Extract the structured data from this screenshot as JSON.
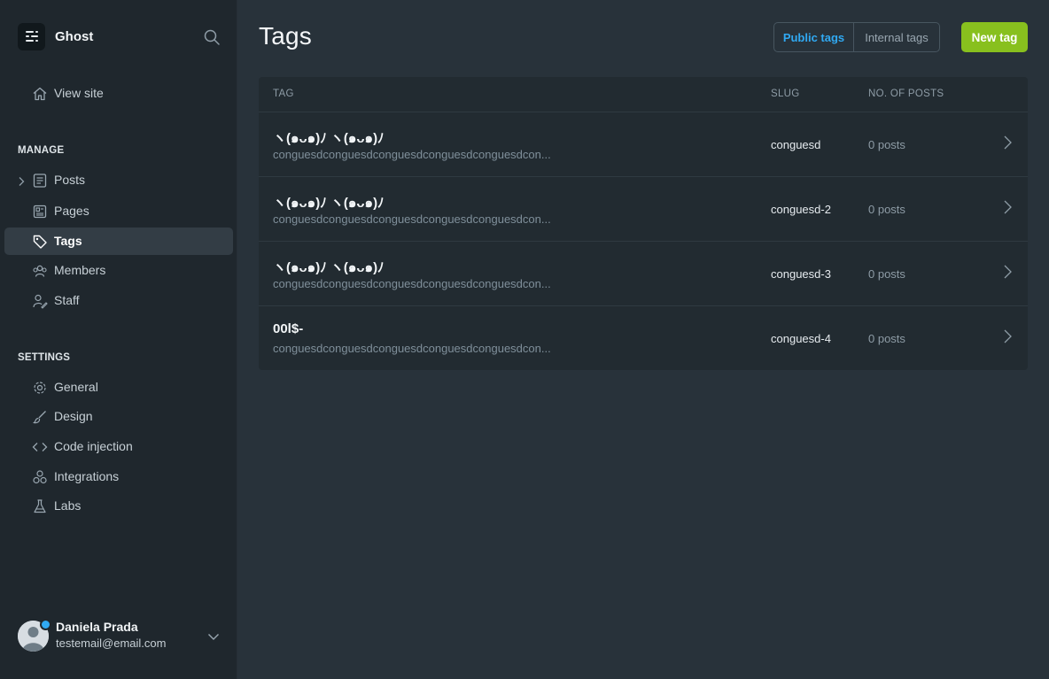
{
  "brand": {
    "name": "Ghost"
  },
  "nav": {
    "view_site": "View site",
    "manage_title": "MANAGE",
    "manage_items": [
      "Posts",
      "Pages",
      "Tags",
      "Members",
      "Staff"
    ],
    "settings_title": "SETTINGS",
    "settings_items": [
      "General",
      "Design",
      "Code injection",
      "Integrations",
      "Labs"
    ]
  },
  "user": {
    "name": "Daniela Prada",
    "email": "testemail@email.com"
  },
  "header": {
    "title": "Tags",
    "public_tab": "Public tags",
    "internal_tab": "Internal tags",
    "new_button": "New tag"
  },
  "table": {
    "columns": [
      "TAG",
      "SLUG",
      "NO. OF POSTS"
    ],
    "rows": [
      {
        "name": "ヽ(๑ᴗ๑)ﾉ ヽ(๑ᴗ๑)ﾉ",
        "description": "conguesdconguesdconguesdconguesdconguesdcon...",
        "slug": "conguesd",
        "posts": "0 posts"
      },
      {
        "name": "ヽ(๑ᴗ๑)ﾉ ヽ(๑ᴗ๑)ﾉ",
        "description": "conguesdconguesdconguesdconguesdconguesdcon...",
        "slug": "conguesd-2",
        "posts": "0 posts"
      },
      {
        "name": "ヽ(๑ᴗ๑)ﾉ ヽ(๑ᴗ๑)ﾉ",
        "description": "conguesdconguesdconguesdconguesdconguesdcon...",
        "slug": "conguesd-3",
        "posts": "0 posts"
      },
      {
        "name": "00l$-",
        "description": "conguesdconguesdconguesdconguesdconguesdcon...",
        "slug": "conguesd-4",
        "posts": "0 posts"
      }
    ]
  },
  "colors": {
    "accent": "#30a9f2",
    "primary_button": "#88c01e",
    "sidebar_bg": "#1f272d",
    "main_bg": "#28323a"
  }
}
